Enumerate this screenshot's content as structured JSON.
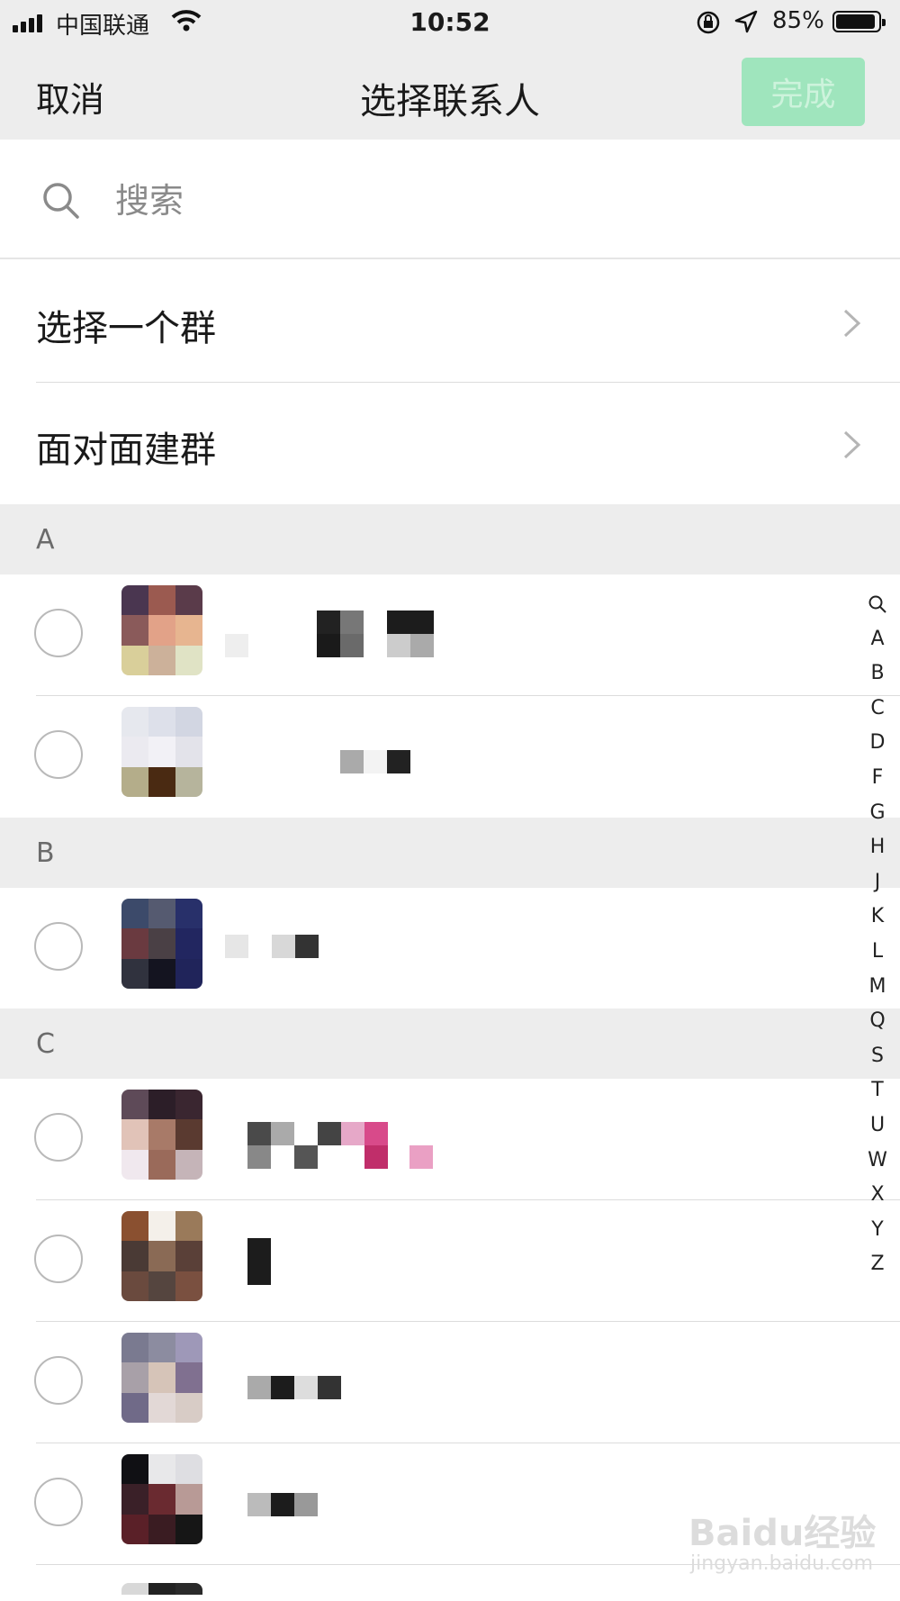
{
  "status_bar": {
    "carrier": "中国联通",
    "time": "10:52",
    "battery_percent": "85%"
  },
  "nav": {
    "cancel": "取消",
    "title": "选择联系人",
    "done": "完成"
  },
  "search": {
    "placeholder": "搜索"
  },
  "menu": {
    "select_group": "选择一个群",
    "face_to_face": "面对面建群"
  },
  "sections": [
    {
      "letter": "A"
    },
    {
      "letter": "B"
    },
    {
      "letter": "C"
    }
  ],
  "index_bar": [
    "A",
    "B",
    "C",
    "D",
    "F",
    "G",
    "H",
    "J",
    "K",
    "L",
    "M",
    "Q",
    "S",
    "T",
    "U",
    "W",
    "X",
    "Y",
    "Z"
  ],
  "watermark": {
    "logo": "Baidu经验",
    "url": "jingyan.baidu.com"
  },
  "colors": {
    "accent_disabled": "#9fe5bd",
    "section_bg": "#ededed"
  }
}
